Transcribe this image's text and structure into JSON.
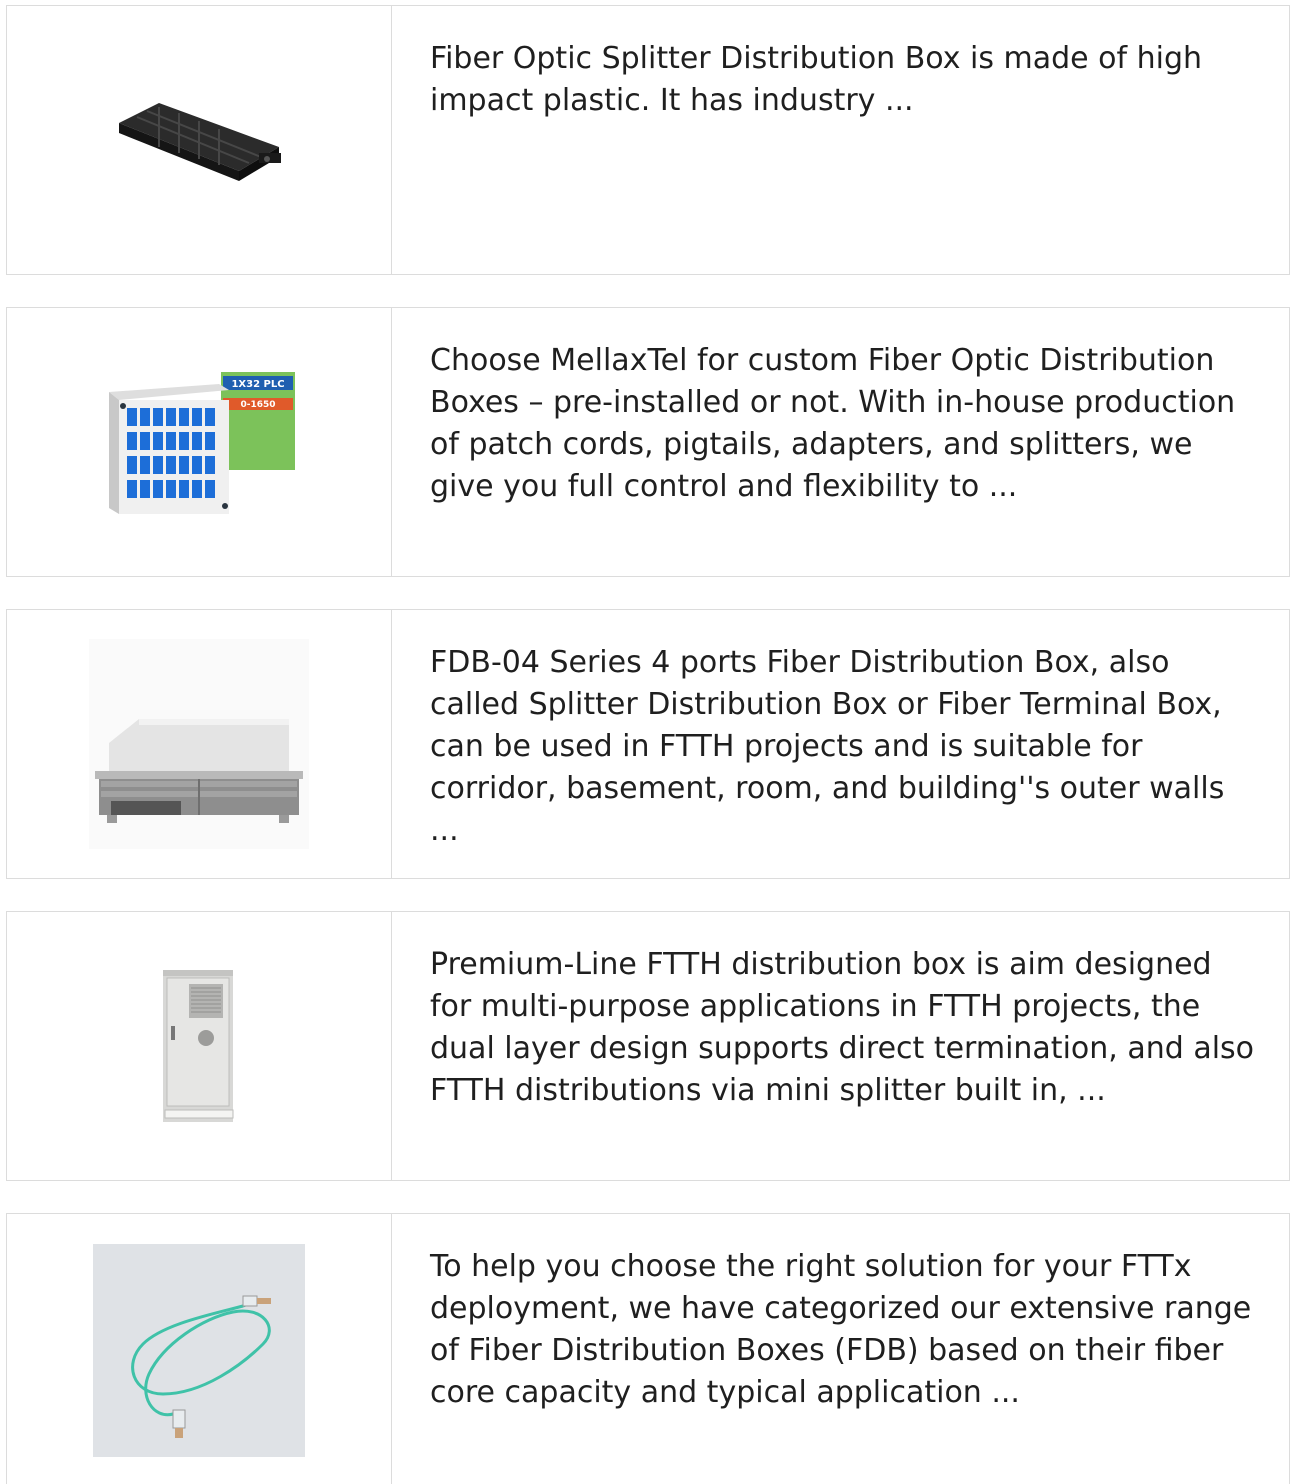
{
  "products": [
    {
      "icon": "fiber-closure-image",
      "description": "Fiber Optic Splitter Distribution Box is made of high impact plastic. It has industry ..."
    },
    {
      "icon": "plc-splitter-box-image",
      "description": "Choose MellaxTel for custom Fiber Optic Distribution Boxes – pre-installed or not. With in-house production of patch cords, pigtails, adapters, and splitters, we give you full control and flexibility to ...",
      "image_labels": [
        "1X32 PLC",
        "0-1650"
      ]
    },
    {
      "icon": "rack-distribution-box-image",
      "description": "FDB-04 Series 4 ports Fiber Distribution Box, also called Splitter Distribution Box or Fiber Terminal Box, can be used in FTTH projects and is suitable for corridor, basement, room, and building''s outer walls ..."
    },
    {
      "icon": "outdoor-cabinet-image",
      "description": "Premium-Line FTTH distribution box is aim designed for multi-purpose applications in FTTH projects, the dual layer design supports direct termination, and also FTTH distributions via mini splitter built in, ..."
    },
    {
      "icon": "patch-cord-image",
      "description": "To help you choose the right solution for your FTTx deployment, we have categorized our extensive range of Fiber Distribution Boxes (FDB) based on their fiber core capacity and typical application ..."
    }
  ]
}
